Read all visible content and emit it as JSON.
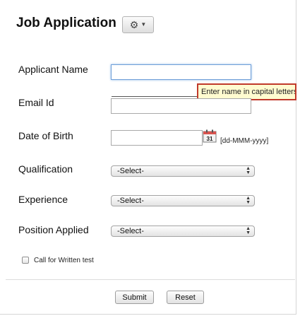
{
  "form": {
    "title": "Job Application",
    "gear_icon": "gear-icon"
  },
  "fields": {
    "applicant_name": {
      "label": "Applicant Name",
      "value": ""
    },
    "email": {
      "label": "Email Id",
      "value": ""
    },
    "dob": {
      "label": "Date of Birth",
      "value": "",
      "format_hint": "[dd-MMM-yyyy]",
      "calendar_day": "31"
    },
    "qualification": {
      "label": "Qualification",
      "selected": "-Select-"
    },
    "experience": {
      "label": "Experience",
      "selected": "-Select-"
    },
    "position": {
      "label": "Position Applied",
      "selected": "-Select-"
    },
    "written_test": {
      "label": "Call for Written test",
      "checked": false
    }
  },
  "tooltip": {
    "text": "Enter name in capital letters"
  },
  "buttons": {
    "submit": "Submit",
    "reset": "Reset"
  },
  "colors": {
    "tooltip_border": "#c0392b",
    "tooltip_bg": "#fffbd0",
    "focus_border": "#6f9fd8"
  }
}
